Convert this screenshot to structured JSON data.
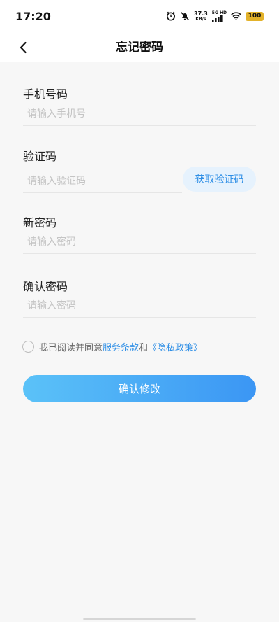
{
  "status_bar": {
    "time": "17:20",
    "net_speed_value": "37.3",
    "net_speed_unit": "KB/s",
    "signal_label": "5G HD",
    "battery": "100",
    "icons": [
      "alarm-icon",
      "mute-icon",
      "signal-icon",
      "wifi-icon",
      "battery-icon"
    ]
  },
  "navbar": {
    "title": "忘记密码",
    "back_icon": "chevron-left-icon"
  },
  "form": {
    "phone": {
      "label": "手机号码",
      "placeholder": "请输入手机号",
      "value": ""
    },
    "code": {
      "label": "验证码",
      "placeholder": "请输入验证码",
      "value": "",
      "get_code_label": "获取验证码"
    },
    "new_password": {
      "label": "新密码",
      "placeholder": "请输入密码",
      "value": ""
    },
    "confirm_password": {
      "label": "确认密码",
      "placeholder": "请输入密码",
      "value": ""
    }
  },
  "agreement": {
    "prefix": "我已阅读并同意",
    "terms_link": "服务条款",
    "conjunction": "和",
    "privacy_link": "《隐私政策》",
    "checked": false
  },
  "submit": {
    "label": "确认修改"
  },
  "colors": {
    "accent": "#2f8fe6",
    "button_gradient_start": "#5bc2f8",
    "button_gradient_end": "#3b96f4",
    "background": "#f7f7f7",
    "battery": "#e3b22a"
  }
}
